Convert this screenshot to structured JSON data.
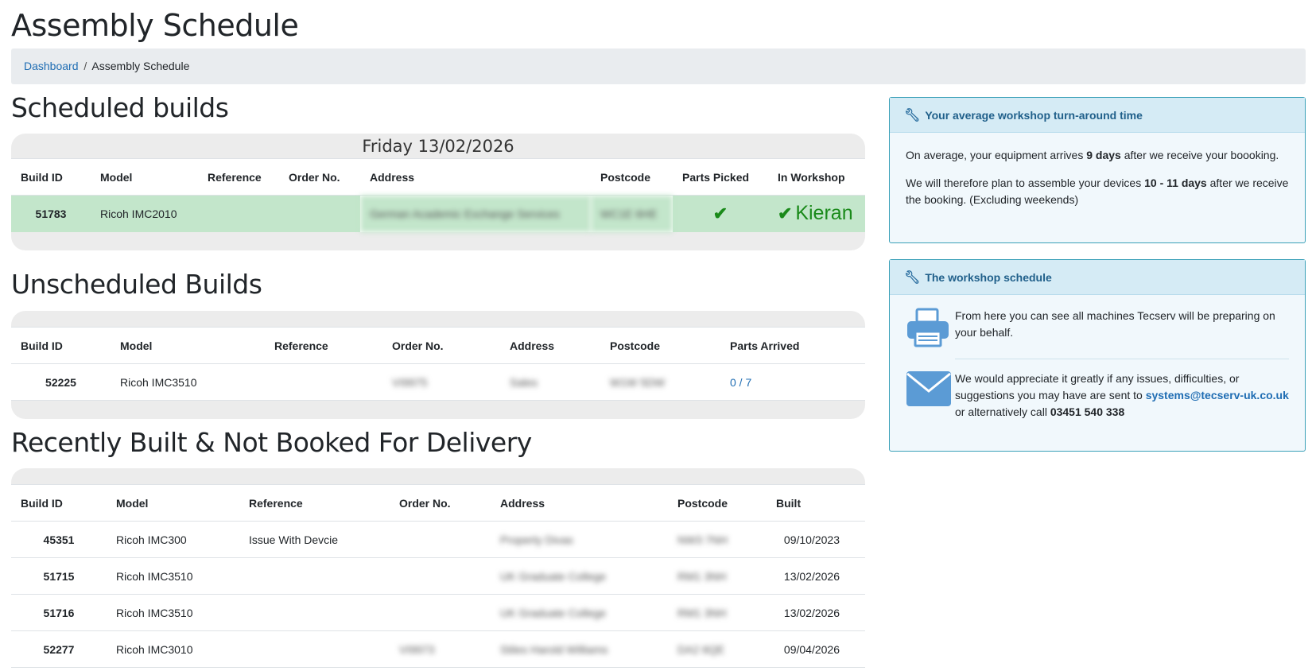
{
  "page": {
    "title": "Assembly Schedule"
  },
  "breadcrumb": {
    "home": "Dashboard",
    "separator": "/",
    "current": "Assembly Schedule"
  },
  "scheduled": {
    "title": "Scheduled builds",
    "date": "Friday 13/02/2026",
    "columns": [
      "Build ID",
      "Model",
      "Reference",
      "Order No.",
      "Address",
      "Postcode",
      "Parts Picked",
      "In Workshop"
    ],
    "rows": [
      {
        "id": "51783",
        "model": "Ricoh IMC2010",
        "reference": "",
        "order_no": "",
        "address": "German Academic Exchange Services",
        "postcode": "WC1E 6HE",
        "parts_picked": "✔",
        "in_workshop": "Kieran",
        "in_workshop_icon": "check-icon"
      }
    ]
  },
  "unscheduled": {
    "title": "Unscheduled Builds",
    "columns": [
      "Build ID",
      "Model",
      "Reference",
      "Order No.",
      "Address",
      "Postcode",
      "Parts Arrived"
    ],
    "rows": [
      {
        "id": "52225",
        "model": "Ricoh IMC3510",
        "reference": "",
        "order_no": "VI9975",
        "address": "Sales",
        "postcode": "W1W 5DW",
        "parts_arrived": "0 / 7"
      }
    ]
  },
  "recent": {
    "title": "Recently Built & Not Booked For Delivery",
    "columns": [
      "Build ID",
      "Model",
      "Reference",
      "Order No.",
      "Address",
      "Postcode",
      "Built"
    ],
    "rows": [
      {
        "id": "45351",
        "model": "Ricoh IMC300",
        "reference": "Issue With Devcie",
        "order_no": "",
        "address": "Property Divas",
        "postcode": "NW3 7NH",
        "built": "09/10/2023"
      },
      {
        "id": "51715",
        "model": "Ricoh IMC3510",
        "reference": "",
        "order_no": "",
        "address": "UK Graduate College",
        "postcode": "RM1 3NH",
        "built": "13/02/2026"
      },
      {
        "id": "51716",
        "model": "Ricoh IMC3510",
        "reference": "",
        "order_no": "",
        "address": "UK Graduate College",
        "postcode": "RM1 3NH",
        "built": "13/02/2026"
      },
      {
        "id": "52277",
        "model": "Ricoh IMC3010",
        "reference": "",
        "order_no": "VI9973",
        "address": "Stiles Harold Williams",
        "postcode": "DA2 6QE",
        "built": "09/04/2026"
      }
    ]
  },
  "turnaround_card": {
    "title": "Your average workshop turn-around time",
    "p1_pre": "On average, your equipment arrives ",
    "p1_bold": "9 days",
    "p1_post": " after we receive your boooking.",
    "p2_pre": "We will therefore plan to assemble your devices ",
    "p2_bold": "10 - 11 days",
    "p2_post": " after we receive the booking. (Excluding weekends)"
  },
  "schedule_card": {
    "title": "The workshop schedule",
    "info": "From here you can see all machines Tecserv will be preparing on your behalf.",
    "contact_pre": "We would appreciate it greatly if any issues, difficulties, or suggestions you may have are sent to ",
    "email": "systems@tecserv-uk.co.uk",
    "contact_mid": " or alternatively call ",
    "phone": "03451 540 338"
  },
  "colors": {
    "accent": "#1f6db3",
    "success_row": "#c3e6cb",
    "success_text": "#1a8a1a",
    "card_border": "#3aa0b8"
  }
}
